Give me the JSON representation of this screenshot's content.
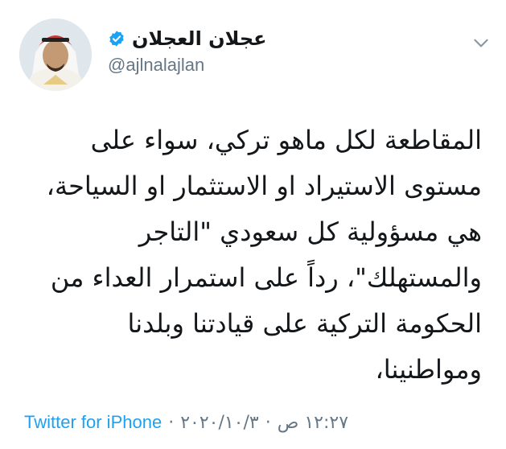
{
  "author": {
    "display_name": "عجلان العجلان",
    "handle": "@ajlnalajlan",
    "verified_icon": "verified-badge-icon",
    "avatar_icon": "avatar"
  },
  "menu_icon": "chevron-down-icon",
  "tweet": {
    "lines": [
      "المقاطعة لكل ماهو تركي، سواء على",
      "مستوى الاستيراد او الاستثمار او السياحة،",
      "هي مسؤولية كل سعودي \"التاجر",
      "والمستهلك\"، رداً على استمرار العداء من",
      "الحكومة التركية على قيادتنا وبلدنا",
      "ومواطنينا،"
    ]
  },
  "meta": {
    "source": "Twitter for iPhone",
    "separator": "·",
    "date": "٢٠٢٠/١٠/٣",
    "time": "١٢:٢٧ ص"
  },
  "colors": {
    "link": "#1da1f2",
    "muted": "#657786",
    "text": "#14171a"
  }
}
